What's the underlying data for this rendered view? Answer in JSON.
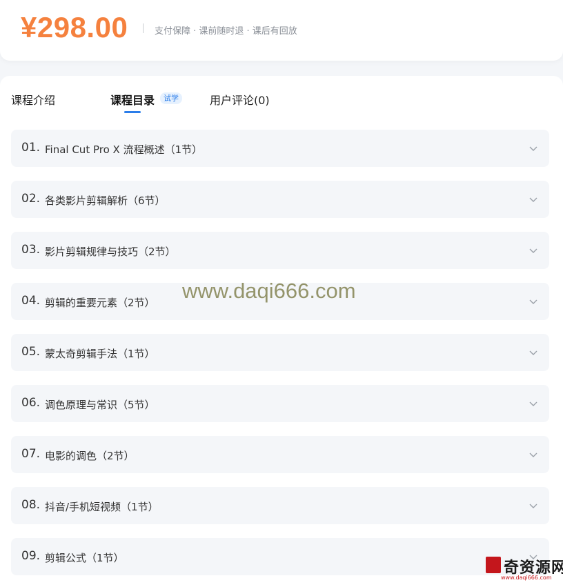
{
  "price_bar": {
    "price": "¥298.00",
    "guarantee": "支付保障 · 课前随时退 · 课后有回放"
  },
  "tabs": [
    {
      "label": "课程介绍",
      "active": false
    },
    {
      "label": "课程目录",
      "active": true,
      "badge": "试学"
    },
    {
      "label": "用户评论(0)",
      "active": false
    }
  ],
  "chapters": [
    {
      "num": "01.",
      "title": "Final Cut Pro X 流程概述（1节）"
    },
    {
      "num": "02.",
      "title": "各类影片剪辑解析（6节）"
    },
    {
      "num": "03.",
      "title": "影片剪辑规律与技巧（2节）"
    },
    {
      "num": "04.",
      "title": "剪辑的重要元素（2节）"
    },
    {
      "num": "05.",
      "title": "蒙太奇剪辑手法（1节）"
    },
    {
      "num": "06.",
      "title": "调色原理与常识（5节）"
    },
    {
      "num": "07.",
      "title": "电影的调色（2节）"
    },
    {
      "num": "08.",
      "title": "抖音/手机短视频（1节）"
    },
    {
      "num": "09.",
      "title": "剪辑公式（1节）"
    }
  ],
  "watermark": "www.daqi666.com",
  "logo": {
    "text": "奇资源网",
    "url": "www.daqi666.com"
  },
  "colors": {
    "price": "#f5813e",
    "accent": "#2b7de9",
    "chapter_bg": "#f4f6f9"
  },
  "icons": {
    "chevron": "chevron-down-icon"
  }
}
